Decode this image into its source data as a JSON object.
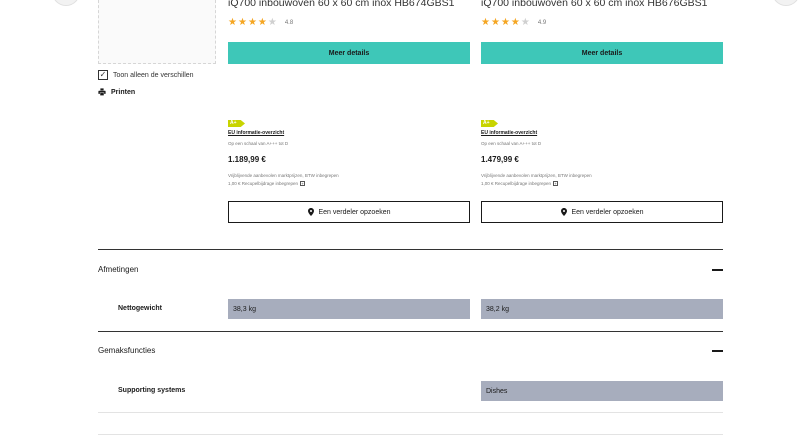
{
  "products": [
    {
      "title": "iQ700  inbouwoven  60 x 60 cm  inox  HB674GBS1",
      "rating": 4.8,
      "rating_label": "4.8",
      "stars_filled": 4,
      "details_label": "Meer details",
      "energy_class": "A+",
      "eu_link": "EU informatie-overzicht",
      "scale_text": "Op een schaal van A+++ tot D",
      "price": "1.189,99 €",
      "price_note": "Vrijblijvende aanbevolen marktprijzen, BTW inbegrepen",
      "recupel_note": "1,00 € Recupelbijdrage inbegrepen",
      "dealer_label": "Een verdeler opzoeken"
    },
    {
      "title": "iQ700  inbouwoven  60 x 60 cm  inox  HB676GBS1",
      "rating": 4.9,
      "rating_label": "4.9",
      "stars_filled": 4,
      "details_label": "Meer details",
      "energy_class": "A+",
      "eu_link": "EU informatie-overzicht",
      "scale_text": "Op een schaal van A+++ tot D",
      "price": "1.479,99 €",
      "price_note": "Vrijblijvende aanbevolen marktprijzen, BTW inbegrepen",
      "recupel_note": "1,00 € Recupelbijdrage inbegrepen",
      "dealer_label": "Een verdeler opzoeken"
    }
  ],
  "controls": {
    "only_differences_label": "Toon alleen de verschillen",
    "only_differences_checked": true,
    "print_label": "Printen"
  },
  "sections": {
    "dimensions": {
      "title": "Afmetingen",
      "rows": [
        {
          "label": "Nettogewicht",
          "values": [
            "38,3 kg",
            "38,2 kg"
          ]
        }
      ]
    },
    "comfort": {
      "title": "Gemaksfuncties",
      "rows": [
        {
          "label": "Supporting systems",
          "values": [
            "",
            "Dishes"
          ]
        }
      ]
    }
  },
  "colors": {
    "accent": "#3ec7b8",
    "cell_bg": "#a7adbd",
    "energy_badge": "#c8d400",
    "star": "#f5a623"
  }
}
